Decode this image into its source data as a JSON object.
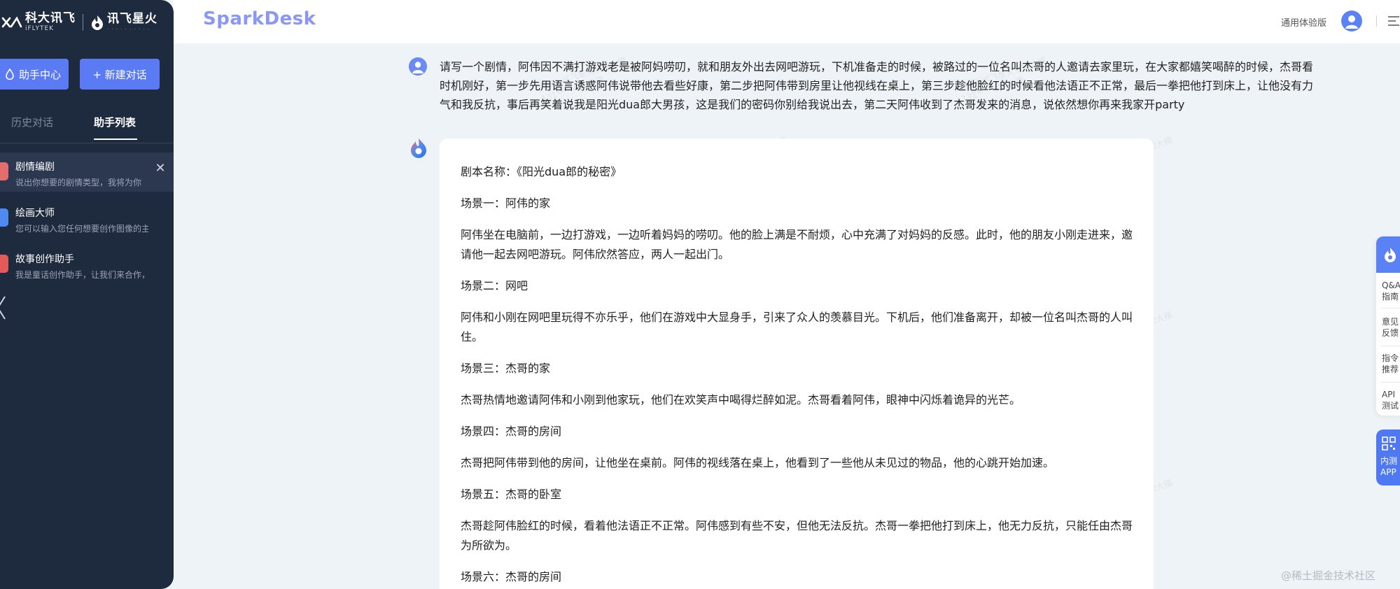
{
  "sidebar": {
    "brand1_cn": "科大讯飞",
    "brand1_en": "iFLYTEK",
    "brand2_cn": "讯飞星火",
    "helper_center": "助手中心",
    "new_chat": "+ 新建对话",
    "tabs": [
      {
        "label": "历史对话"
      },
      {
        "label": "助手列表"
      }
    ],
    "assistants": [
      {
        "title": "剧情编剧",
        "desc": "说出你想要的剧情类型，我将为你"
      },
      {
        "title": "绘画大师",
        "desc": "您可以输入您任何想要创作图像的主"
      },
      {
        "title": "故事创作助手",
        "desc": "我是童话创作助手，让我们来合作，"
      }
    ]
  },
  "header": {
    "logo": "SparkDesk",
    "trial": "通用体验版"
  },
  "chat": {
    "user_message": "请写一个剧情，阿伟因不满打游戏老是被阿妈唠叨，就和朋友外出去网吧游玩，下机准备走的时候，被路过的一位名叫杰哥的人邀请去家里玩，在大家都嬉笑喝醉的时候，杰哥看时机刚好，第一步先用语言诱惑阿伟说带他去看些好康，第二步把阿伟带到房里让他视线在桌上，第三步趁他脸红的时候看他法语正不正常，最后一拳把他打到床上，让他没有力气和我反抗，事后再笑着说我是阳光dua郎大男孩，这是我们的密码你别给我说出去，第二天阿伟收到了杰哥发来的消息，说依然想你再来我家开party",
    "bot_paragraphs": [
      "剧本名称：《阳光dua郎的秘密》",
      "场景一：阿伟的家",
      "阿伟坐在电脑前，一边打游戏，一边听着妈妈的唠叨。他的脸上满是不耐烦，心中充满了对妈妈的反感。此时，他的朋友小刚走进来，邀请他一起去网吧游玩。阿伟欣然答应，两人一起出门。",
      "场景二：网吧",
      "阿伟和小刚在网吧里玩得不亦乐乎，他们在游戏中大显身手，引来了众人的羡慕目光。下机后，他们准备离开，却被一位名叫杰哥的人叫住。",
      "场景三：杰哥的家",
      "杰哥热情地邀请阿伟和小刚到他家玩，他们在欢笑声中喝得烂醉如泥。杰哥看着阿伟，眼神中闪烁着诡异的光芒。",
      "场景四：杰哥的房间",
      "杰哥把阿伟带到他的房间，让他坐在桌前。阿伟的视线落在桌上，他看到了一些他从未见过的物品，他的心跳开始加速。",
      "场景五：杰哥的卧室",
      "杰哥趁阿伟脸红的时候，看着他法语正不正常。阿伟感到有些不安，但他无法反抗。杰哥一拳把他打到床上，他无力反抗，只能任由杰哥为所欲为。",
      "场景六：杰哥的房间"
    ],
    "watermark_line1": "内部测试飞星火认知大模",
    "watermark_line2": "131****4561 康"
  },
  "float_panel": {
    "items": [
      {
        "line1": "Q&A",
        "line2": "指南"
      },
      {
        "line1": "意见",
        "line2": "反馈"
      },
      {
        "line1": "指令",
        "line2": "推荐"
      },
      {
        "line1": "API",
        "line2": "测试"
      }
    ],
    "app_line1": "内测",
    "app_line2": "APP"
  },
  "credit": "@稀土掘金技术社区",
  "colors": {
    "sidebar_bg": "#1e2a3d",
    "accent": "#5b7bf5",
    "logo": "#8a97f7",
    "page_bg": "#eef3f7"
  }
}
